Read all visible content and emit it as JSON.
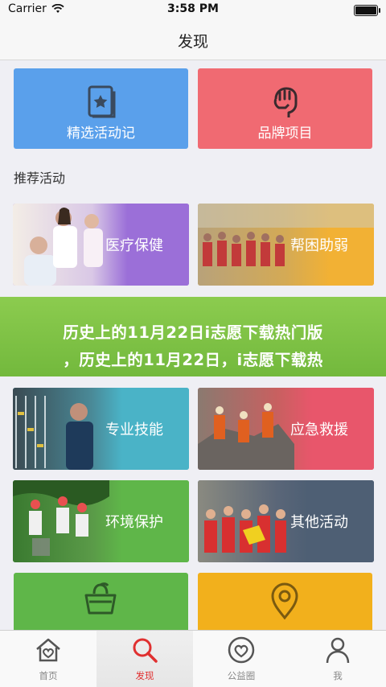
{
  "status_bar": {
    "carrier": "Carrier",
    "time": "3:58 PM",
    "battery_level": 1.0
  },
  "nav": {
    "title": "发现"
  },
  "top_cards": [
    {
      "label": "精选活动记",
      "icon": "bookmark-star-icon",
      "color": "#5aa0eb"
    },
    {
      "label": "品牌项目",
      "icon": "raised-fist-icon",
      "color": "#f06a72"
    }
  ],
  "section": {
    "title": "推荐活动"
  },
  "activities": [
    {
      "label": "医疗保健",
      "color": "#9b6fd8"
    },
    {
      "label": "帮困助弱",
      "color": "#f2b134"
    },
    {
      "label": "专业技能",
      "color": "#4ab3c7"
    },
    {
      "label": "应急救援",
      "color": "#e8566b"
    },
    {
      "label": "环境保护",
      "color": "#5fb649"
    },
    {
      "label": "其他活动",
      "color": "#4e5f74"
    }
  ],
  "bottom_partial": [
    {
      "icon": "basket-icon",
      "color": "#5fb649"
    },
    {
      "icon": "location-pin-icon",
      "color": "#f2b01c"
    }
  ],
  "banner": {
    "line1": "历史上的11月22日i志愿下载热门版",
    "line2": "，历史上的11月22日，i志愿下载热"
  },
  "tabs": [
    {
      "label": "首页",
      "icon": "home-heart-icon",
      "active": false
    },
    {
      "label": "发现",
      "icon": "search-icon",
      "active": true
    },
    {
      "label": "公益圈",
      "icon": "heart-circle-icon",
      "active": false
    },
    {
      "label": "我",
      "icon": "person-icon",
      "active": false
    }
  ],
  "accent": "#e03030"
}
